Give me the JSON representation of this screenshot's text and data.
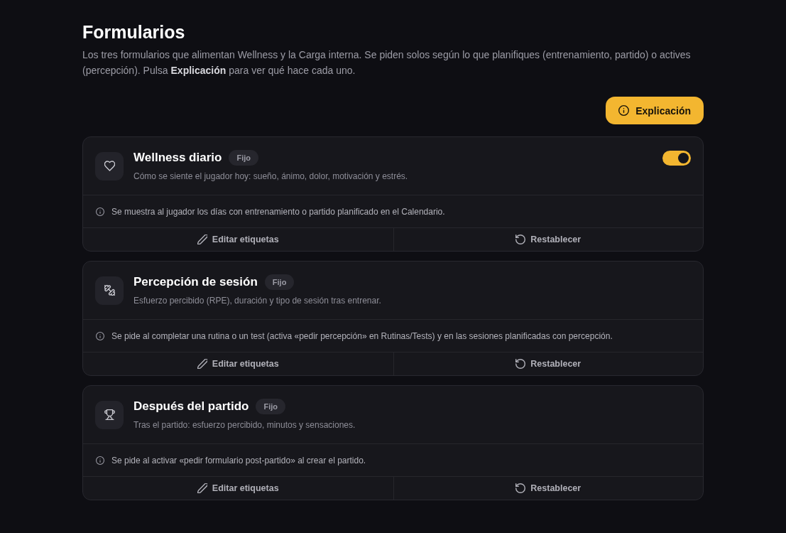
{
  "page": {
    "title": "Formularios",
    "description": "Los tres formularios que alimentan Wellness y la Carga interna. Se piden solos según lo que planifiques (entrenamiento, partido) o actives (percepción). Pulsa **Explicación** para ver qué hace cada uno."
  },
  "explain_button": {
    "label": "Explicación"
  },
  "forms": [
    {
      "title": "Wellness diario",
      "badge": "Fijo",
      "subtitle": "Cómo se siente el jugador hoy: sueño, ánimo, dolor, motivación y estrés.",
      "toggle": {
        "on": true
      },
      "info": "Se muestra al jugador los días con entrenamiento o partido planificado en el Calendario.",
      "actions": [
        {
          "kind": "edit",
          "label": "Editar etiquetas"
        },
        {
          "kind": "reset",
          "label": "Restablecer"
        }
      ]
    },
    {
      "title": "Percepción de sesión",
      "badge": "Fijo",
      "subtitle": "Esfuerzo percibido (RPE), duración y tipo de sesión tras entrenar.",
      "info": "Se pide al completar una rutina o un test (activa «pedir percepción» en Rutinas/Tests) y en las sesiones planificadas con percepción.",
      "actions": [
        {
          "kind": "edit",
          "label": "Editar etiquetas"
        },
        {
          "kind": "reset",
          "label": "Restablecer"
        }
      ]
    },
    {
      "title": "Después del partido",
      "badge": "Fijo",
      "subtitle": "Tras el partido: esfuerzo percibido, minutos y sensaciones.",
      "info": "Se pide al activar «pedir formulario post-partido» al crear el partido.",
      "actions": [
        {
          "kind": "edit",
          "label": "Editar etiquetas"
        },
        {
          "kind": "reset",
          "label": "Restablecer"
        }
      ]
    }
  ]
}
